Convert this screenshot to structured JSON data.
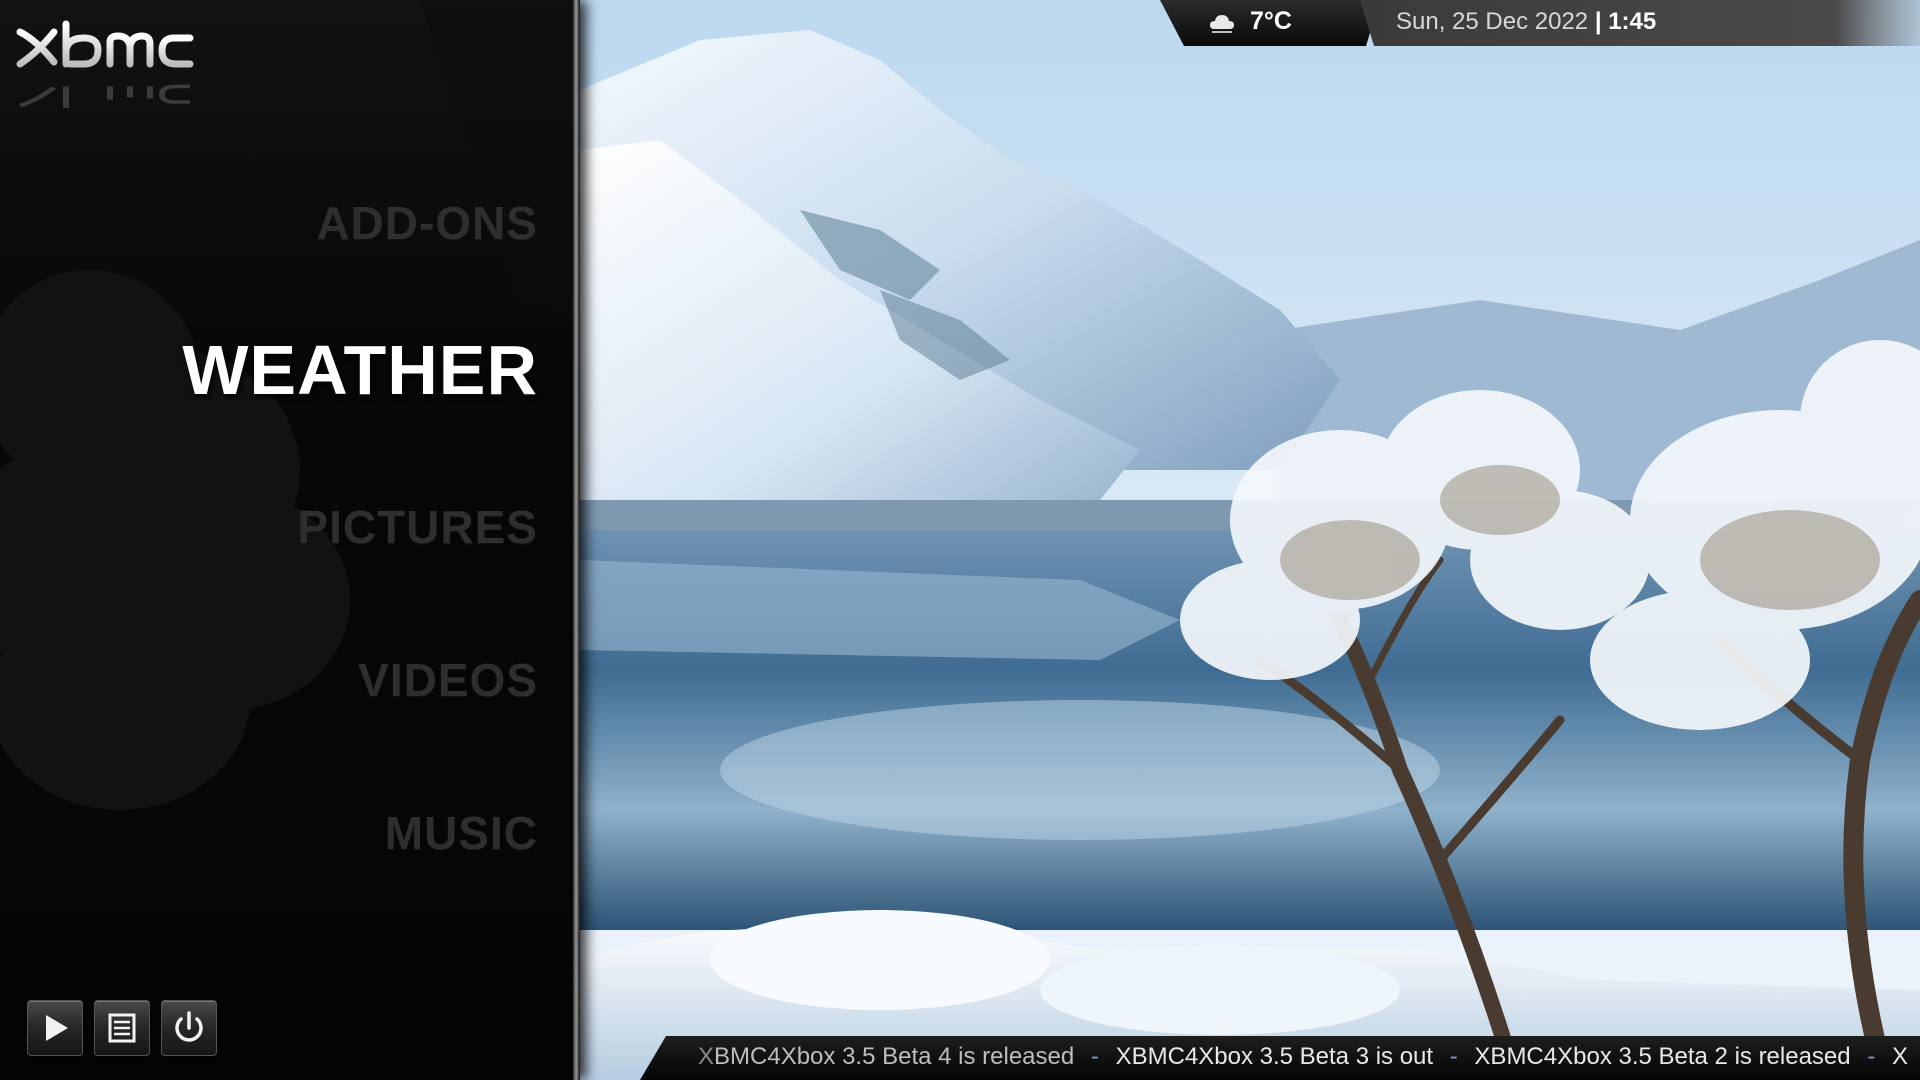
{
  "app": {
    "logo_text": "XBMC"
  },
  "menu": {
    "items": [
      {
        "id": "addons",
        "label": "ADD-ONS",
        "state": "inactive"
      },
      {
        "id": "weather",
        "label": "WEATHER",
        "state": "active"
      },
      {
        "id": "pictures",
        "label": "PICTURES",
        "state": "inactive"
      },
      {
        "id": "videos",
        "label": "VIDEOS",
        "state": "inactive"
      },
      {
        "id": "music",
        "label": "MUSIC",
        "state": "inactive"
      }
    ]
  },
  "controls": {
    "play_icon": "play-icon",
    "list_icon": "list-icon",
    "power_icon": "power-icon"
  },
  "status": {
    "weather_icon": "cloud-icon",
    "temperature": "7°C",
    "date": "Sun, 25 Dec 2022",
    "separator": "|",
    "time": "1:45"
  },
  "ticker": {
    "first_prefix": "X",
    "items": [
      "BMC4Xbox 3.5 Beta 4 is released",
      "XBMC4Xbox 3.5 Beta 3 is out",
      "XBMC4Xbox 3.5 Beta 2 is released",
      "X"
    ],
    "separator": "-"
  },
  "colors": {
    "panel_background": "#080808",
    "active_text": "#ffffff",
    "inactive_text": "#2e2e2e",
    "ticker_separator": "#7a9ad0",
    "status_text": "#d8d8d8"
  }
}
